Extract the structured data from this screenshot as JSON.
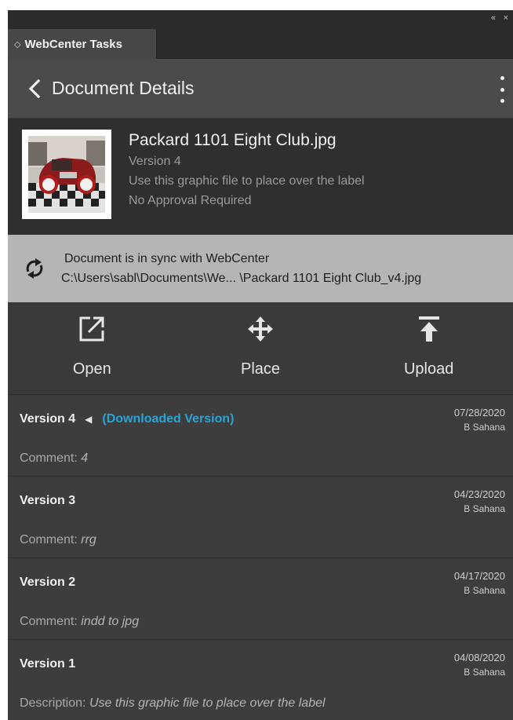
{
  "window": {
    "collapse_glyph": "«",
    "close_glyph": "×"
  },
  "tab": {
    "glyph": "◇",
    "label": "WebCenter Tasks"
  },
  "header": {
    "title": "Document Details",
    "back_icon": "chevron-left-icon",
    "menu_icon": "kebab-menu-icon"
  },
  "document": {
    "name": "Packard 1101 Eight Club.jpg",
    "version": "Version 4",
    "description": "Use this graphic file to place over the label",
    "approval": "No Approval Required"
  },
  "sync": {
    "status": "Document is in sync with WebCenter",
    "path": "C:\\Users\\sabl\\Documents\\We... \\Packard 1101 Eight Club_v4.jpg",
    "icon": "sync-icon"
  },
  "actions": [
    {
      "label": "Open",
      "icon": "open-external-icon"
    },
    {
      "label": "Place",
      "icon": "move-arrows-icon"
    },
    {
      "label": "Upload",
      "icon": "upload-icon"
    }
  ],
  "versions": [
    {
      "title": "Version 4",
      "marker": "◀",
      "note": "(Downloaded Version)",
      "date": "07/28/2020",
      "user": "B Sahana",
      "comment_label": "Comment:",
      "comment": "4"
    },
    {
      "title": "Version 3",
      "marker": "",
      "note": "",
      "date": "04/23/2020",
      "user": "B Sahana",
      "comment_label": "Comment:",
      "comment": "rrg"
    },
    {
      "title": "Version 2",
      "marker": "",
      "note": "",
      "date": "04/17/2020",
      "user": "B Sahana",
      "comment_label": "Comment:",
      "comment": "indd to jpg"
    },
    {
      "title": "Version 1",
      "marker": "",
      "note": "",
      "date": "04/08/2020",
      "user": "B Sahana",
      "comment_label": "Description:",
      "comment": "Use this graphic file to place over the label"
    }
  ],
  "colors": {
    "accent": "#2aa4d6",
    "panel": "#3a3a3a",
    "syncbar": "#b5b5b5"
  }
}
